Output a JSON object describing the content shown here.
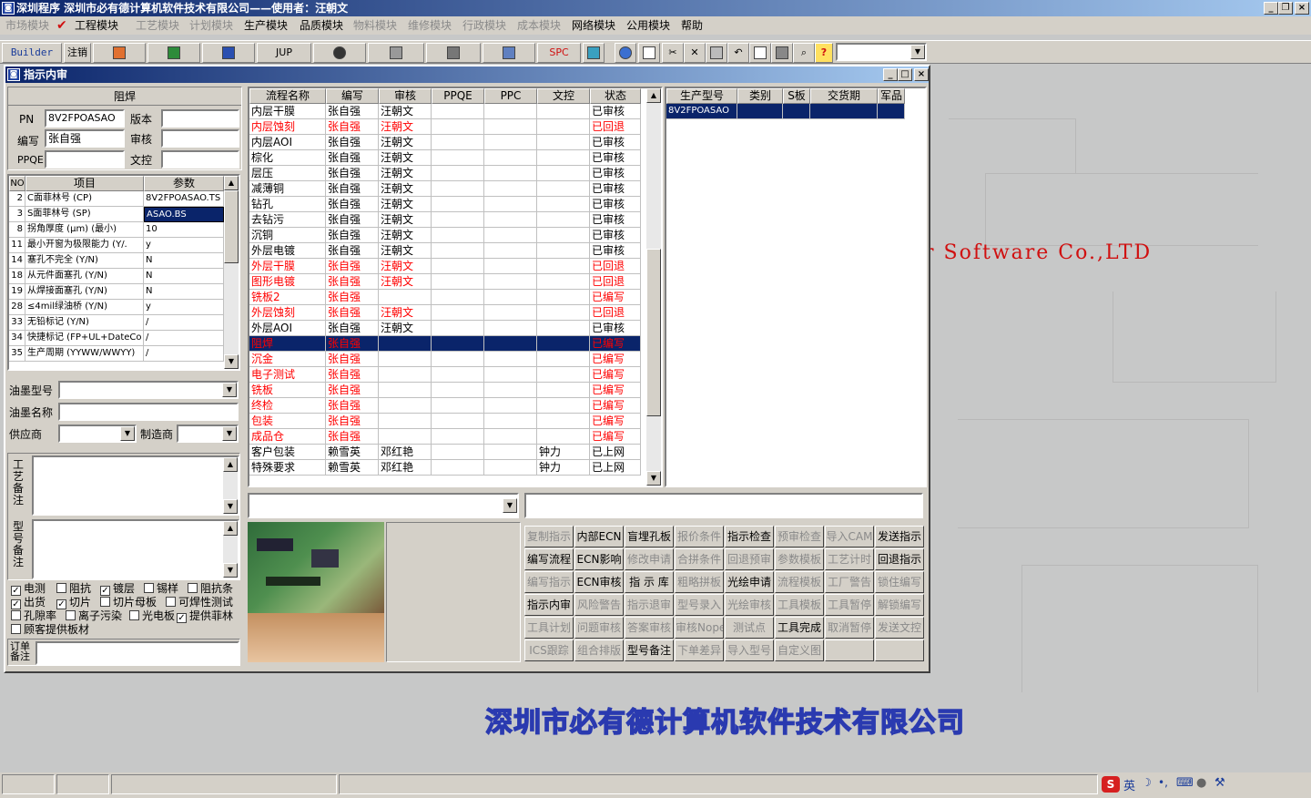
{
  "app": {
    "title": "深圳程序   深圳市必有德计算机软件技术有限公司——使用者：汪朝文",
    "menu": [
      {
        "label": "市场模块",
        "enabled": false
      },
      {
        "label": "工程模块",
        "enabled": true
      },
      {
        "label": "工艺模块",
        "enabled": false
      },
      {
        "label": "计划模块",
        "enabled": false
      },
      {
        "label": "生产模块",
        "enabled": true
      },
      {
        "label": "品质模块",
        "enabled": true
      },
      {
        "label": "物料模块",
        "enabled": false
      },
      {
        "label": "维修模块",
        "enabled": false
      },
      {
        "label": "行政模块",
        "enabled": false
      },
      {
        "label": "成本模块",
        "enabled": false
      },
      {
        "label": "网络模块",
        "enabled": true
      },
      {
        "label": "公用模块",
        "enabled": true
      },
      {
        "label": "帮助",
        "enabled": true
      }
    ],
    "toolbar": {
      "builder": "Builder",
      "logout": "注销",
      "jup": "JUP",
      "spc": "SPC",
      "help": "?"
    }
  },
  "window": {
    "title": "指示内审"
  },
  "form": {
    "section_title": "阻焊",
    "pn_label": "PN",
    "pn_value": "8V2FPOASAO",
    "version_label": "版本",
    "version_value": "",
    "author_label": "编写",
    "author_value": "张自强",
    "review_label": "审核",
    "review_value": "",
    "ppqe_label": "PPQE",
    "ppqe_value": "",
    "wenkong_label": "文控",
    "wenkong_value": ""
  },
  "params": {
    "headers": [
      "NO",
      "项目",
      "参数"
    ],
    "rows": [
      [
        "2",
        "C面菲林号 (CP)",
        "8V2FPOASAO.TS"
      ],
      [
        "3",
        "S面菲林号 (SP)",
        "ASAO.BS"
      ],
      [
        "8",
        "拐角厚度 (μm) (最小)",
        "10"
      ],
      [
        "11",
        "最小开窗为极限能力 (Y/.",
        "y"
      ],
      [
        "14",
        "塞孔不完全 (Y/N)",
        "N"
      ],
      [
        "18",
        "从元件面塞孔 (Y/N)",
        "N"
      ],
      [
        "19",
        "从焊接面塞孔 (Y/N)",
        "N"
      ],
      [
        "28",
        "≤4mil绿油桥 (Y/N)",
        "y"
      ],
      [
        "33",
        "无铅标记 (Y/N)",
        "/"
      ],
      [
        "34",
        "快捷标记 (FP+UL+DateCo",
        "/"
      ],
      [
        "35",
        "生产周期 (YYWW/WWYY)",
        "/"
      ]
    ]
  },
  "ink": {
    "type_label": "油墨型号",
    "type_value": "",
    "name_label": "油墨名称",
    "name_value": "",
    "supplier_label": "供应商",
    "supplier_value": "",
    "maker_label": "制造商",
    "maker_value": ""
  },
  "notes": {
    "craft_label": "工艺备注",
    "model_label": "型号备注",
    "order_label": "订单备注"
  },
  "checkboxes": [
    {
      "label": "电测",
      "checked": true
    },
    {
      "label": "阻抗",
      "checked": false
    },
    {
      "label": "镀层",
      "checked": true
    },
    {
      "label": "锡样",
      "checked": false
    },
    {
      "label": "阻抗条",
      "checked": false
    },
    {
      "label": "出货",
      "checked": true
    },
    {
      "label": "切片",
      "checked": true
    },
    {
      "label": "切片母板",
      "checked": false
    },
    {
      "label": "可焊性测试",
      "checked": false
    },
    {
      "label": "孔隙率",
      "checked": false
    },
    {
      "label": "离子污染",
      "checked": false
    },
    {
      "label": "光电板",
      "checked": false
    },
    {
      "label": "提供菲林",
      "checked": true
    },
    {
      "label": "顾客提供板材",
      "checked": false
    }
  ],
  "process": {
    "headers": [
      "流程名称",
      "编写",
      "审核",
      "PPQE",
      "PPC",
      "文控",
      "状态"
    ],
    "rows": [
      {
        "c": [
          "内层干膜",
          "张自强",
          "汪朝文",
          "",
          "",
          "",
          "已审核"
        ],
        "s": "normal"
      },
      {
        "c": [
          "内层蚀刻",
          "张自强",
          "汪朝文",
          "",
          "",
          "",
          "已回退"
        ],
        "s": "red"
      },
      {
        "c": [
          "内层AOI",
          "张自强",
          "汪朝文",
          "",
          "",
          "",
          "已审核"
        ],
        "s": "normal"
      },
      {
        "c": [
          "棕化",
          "张自强",
          "汪朝文",
          "",
          "",
          "",
          "已审核"
        ],
        "s": "normal"
      },
      {
        "c": [
          "层压",
          "张自强",
          "汪朝文",
          "",
          "",
          "",
          "已审核"
        ],
        "s": "normal"
      },
      {
        "c": [
          "减薄铜",
          "张自强",
          "汪朝文",
          "",
          "",
          "",
          "已审核"
        ],
        "s": "normal"
      },
      {
        "c": [
          "钻孔",
          "张自强",
          "汪朝文",
          "",
          "",
          "",
          "已审核"
        ],
        "s": "normal"
      },
      {
        "c": [
          "去钻污",
          "张自强",
          "汪朝文",
          "",
          "",
          "",
          "已审核"
        ],
        "s": "normal"
      },
      {
        "c": [
          "沉铜",
          "张自强",
          "汪朝文",
          "",
          "",
          "",
          "已审核"
        ],
        "s": "normal"
      },
      {
        "c": [
          "外层电镀",
          "张自强",
          "汪朝文",
          "",
          "",
          "",
          "已审核"
        ],
        "s": "normal"
      },
      {
        "c": [
          "外层干膜",
          "张自强",
          "汪朝文",
          "",
          "",
          "",
          "已回退"
        ],
        "s": "red"
      },
      {
        "c": [
          "图形电镀",
          "张自强",
          "汪朝文",
          "",
          "",
          "",
          "已回退"
        ],
        "s": "red"
      },
      {
        "c": [
          "铣板2",
          "张自强",
          "",
          "",
          "",
          "",
          "已编写"
        ],
        "s": "red"
      },
      {
        "c": [
          "外层蚀刻",
          "张自强",
          "汪朝文",
          "",
          "",
          "",
          "已回退"
        ],
        "s": "red"
      },
      {
        "c": [
          "外层AOI",
          "张自强",
          "汪朝文",
          "",
          "",
          "",
          "已审核"
        ],
        "s": "normal"
      },
      {
        "c": [
          "阻焊",
          "张自强",
          "",
          "",
          "",
          "",
          "已编写"
        ],
        "s": "selected"
      },
      {
        "c": [
          "沉金",
          "张自强",
          "",
          "",
          "",
          "",
          "已编写"
        ],
        "s": "red"
      },
      {
        "c": [
          "电子测试",
          "张自强",
          "",
          "",
          "",
          "",
          "已编写"
        ],
        "s": "red"
      },
      {
        "c": [
          "铣板",
          "张自强",
          "",
          "",
          "",
          "",
          "已编写"
        ],
        "s": "red"
      },
      {
        "c": [
          "终检",
          "张自强",
          "",
          "",
          "",
          "",
          "已编写"
        ],
        "s": "red"
      },
      {
        "c": [
          "包装",
          "张自强",
          "",
          "",
          "",
          "",
          "已编写"
        ],
        "s": "red"
      },
      {
        "c": [
          "成品仓",
          "张自强",
          "",
          "",
          "",
          "",
          "已编写"
        ],
        "s": "red"
      },
      {
        "c": [
          "客户包装",
          "赖雪英",
          "邓红艳",
          "",
          "",
          "钟力",
          "已上网"
        ],
        "s": "normal"
      },
      {
        "c": [
          "特殊要求",
          "赖雪英",
          "邓红艳",
          "",
          "",
          "钟力",
          "已上网"
        ],
        "s": "normal"
      }
    ]
  },
  "models": {
    "headers": [
      "生产型号",
      "类别",
      "S板",
      "交货期",
      "军品"
    ],
    "rows": [
      [
        "8V2FPOASAO",
        "",
        "",
        "",
        ""
      ]
    ]
  },
  "buttons": [
    [
      {
        "t": "复制指示",
        "e": false
      },
      {
        "t": "内部ECN",
        "e": true
      },
      {
        "t": "盲埋孔板",
        "e": true
      },
      {
        "t": "报价条件",
        "e": false
      },
      {
        "t": "指示检查",
        "e": true
      },
      {
        "t": "预审检查",
        "e": false
      },
      {
        "t": "导入CAM",
        "e": false
      },
      {
        "t": "发送指示",
        "e": true
      }
    ],
    [
      {
        "t": "编写流程",
        "e": true
      },
      {
        "t": "ECN影响",
        "e": true
      },
      {
        "t": "修改申请",
        "e": false
      },
      {
        "t": "合拼条件",
        "e": false
      },
      {
        "t": "回退预审",
        "e": false
      },
      {
        "t": "参数模板",
        "e": false
      },
      {
        "t": "工艺计时",
        "e": false
      },
      {
        "t": "回退指示",
        "e": true
      }
    ],
    [
      {
        "t": "编写指示",
        "e": false
      },
      {
        "t": "ECN审核",
        "e": true
      },
      {
        "t": "指 示 库",
        "e": true
      },
      {
        "t": "粗略拼板",
        "e": false
      },
      {
        "t": "光绘申请",
        "e": true
      },
      {
        "t": "流程模板",
        "e": false
      },
      {
        "t": "工厂警告",
        "e": false
      },
      {
        "t": "锁住编写",
        "e": false
      }
    ],
    [
      {
        "t": "指示内审",
        "e": true
      },
      {
        "t": "风险警告",
        "e": false
      },
      {
        "t": "指示退审",
        "e": false
      },
      {
        "t": "型号录入",
        "e": false
      },
      {
        "t": "光绘审核",
        "e": false
      },
      {
        "t": "工具模板",
        "e": false
      },
      {
        "t": "工具暂停",
        "e": false
      },
      {
        "t": "解锁编写",
        "e": false
      }
    ],
    [
      {
        "t": "工具计划",
        "e": false
      },
      {
        "t": "问题审核",
        "e": false
      },
      {
        "t": "答案审核",
        "e": false
      },
      {
        "t": "审核Nope",
        "e": false
      },
      {
        "t": "测试点",
        "e": false
      },
      {
        "t": "工具完成",
        "e": true
      },
      {
        "t": "取消暂停",
        "e": false
      },
      {
        "t": "发送文控",
        "e": false
      }
    ],
    [
      {
        "t": "ICS跟踪",
        "e": false
      },
      {
        "t": "组合排版",
        "e": false
      },
      {
        "t": "型号备注",
        "e": true
      },
      {
        "t": "下单差异",
        "e": false
      },
      {
        "t": "导入型号",
        "e": false
      },
      {
        "t": "自定义图",
        "e": false
      },
      {
        "t": "",
        "e": false
      },
      {
        "t": "",
        "e": false
      }
    ]
  ],
  "background": {
    "company": "深圳市必有德计算机软件技术有限公司",
    "software": "er Software Co.,LTD"
  },
  "tray": {
    "ime": "英"
  }
}
